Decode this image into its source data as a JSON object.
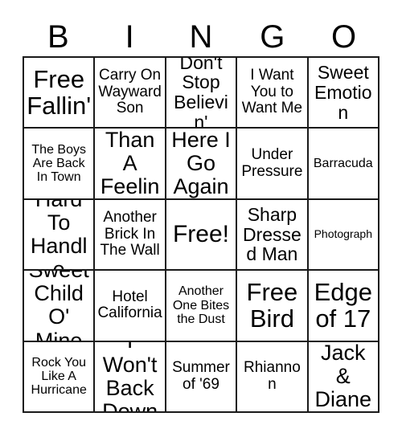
{
  "card": {
    "header_letters": [
      "B",
      "I",
      "N",
      "G",
      "O"
    ],
    "rows": [
      [
        {
          "text": "Free Fallin'",
          "size": "fs-xxl"
        },
        {
          "text": "Carry On Wayward Son",
          "size": "fs-md"
        },
        {
          "text": "Don't Stop Believin'",
          "size": "fs-lg"
        },
        {
          "text": "I Want You to Want Me",
          "size": "fs-md"
        },
        {
          "text": "Sweet Emotion",
          "size": "fs-lg"
        }
      ],
      [
        {
          "text": "The Boys Are Back In Town",
          "size": "fs-sm"
        },
        {
          "text": "More Than A Feeling",
          "size": "fs-xl"
        },
        {
          "text": "Here I Go Again",
          "size": "fs-xl"
        },
        {
          "text": "Under Pressure",
          "size": "fs-md"
        },
        {
          "text": "Barracuda",
          "size": "fs-sm"
        }
      ],
      [
        {
          "text": "Hard To Handle",
          "size": "fs-xl"
        },
        {
          "text": "Another Brick In The Wall",
          "size": "fs-md"
        },
        {
          "text": "Free!",
          "size": "free-cell",
          "is_free": true
        },
        {
          "text": "Sharp Dressed Man",
          "size": "fs-lg"
        },
        {
          "text": "Photograph",
          "size": "fs-xs"
        }
      ],
      [
        {
          "text": "Sweet Child O' Mine",
          "size": "fs-xl"
        },
        {
          "text": "Hotel California",
          "size": "fs-md"
        },
        {
          "text": "Another One Bites the Dust",
          "size": "fs-sm"
        },
        {
          "text": "Free Bird",
          "size": "fs-xxl"
        },
        {
          "text": "Edge of 17",
          "size": "fs-xxl"
        }
      ],
      [
        {
          "text": "Rock You Like A Hurricane",
          "size": "fs-sm"
        },
        {
          "text": "I Won't Back Down",
          "size": "fs-xl"
        },
        {
          "text": "Summer of '69",
          "size": "fs-md"
        },
        {
          "text": "Rhiannon",
          "size": "fs-md"
        },
        {
          "text": "Jack & Diane",
          "size": "fs-xl"
        }
      ]
    ]
  },
  "colors": {
    "background": "#ffffff",
    "border": "#1a1a1a",
    "text": "#000000"
  }
}
